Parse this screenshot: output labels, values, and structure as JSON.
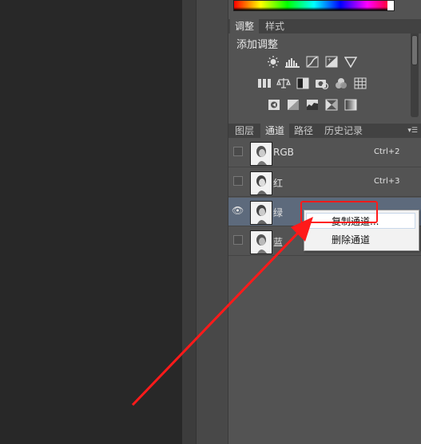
{
  "adjustments_panel": {
    "tabs": [
      {
        "label": "调整",
        "active": true
      },
      {
        "label": "样式",
        "active": false
      }
    ],
    "add_adjustment_label": "添加调整",
    "icons_row1": [
      "brightness-contrast-icon",
      "levels-icon",
      "curves-icon",
      "exposure-icon",
      "vibrance-icon"
    ],
    "icons_row2": [
      "hue-saturation-icon",
      "color-balance-icon",
      "black-white-icon",
      "photo-filter-icon",
      "channel-mixer-icon",
      "color-lookup-icon"
    ],
    "icons_row3": [
      "invert-icon",
      "posterize-icon",
      "threshold-icon",
      "selective-color-icon",
      "gradient-map-icon"
    ]
  },
  "layers_panel": {
    "tabs": [
      {
        "label": "图层",
        "active": false
      },
      {
        "label": "通道",
        "active": true
      },
      {
        "label": "路径",
        "active": false
      },
      {
        "label": "历史记录",
        "active": false
      }
    ],
    "channels": [
      {
        "name": "RGB",
        "shortcut": "Ctrl+2",
        "visible": false,
        "selected": false
      },
      {
        "name": "红",
        "shortcut": "Ctrl+3",
        "visible": false,
        "selected": false
      },
      {
        "name": "绿",
        "shortcut": "",
        "visible": true,
        "selected": true
      },
      {
        "name": "蓝",
        "shortcut": "",
        "visible": false,
        "selected": false
      }
    ]
  },
  "context_menu": {
    "items": [
      {
        "label": "复制通道..."
      },
      {
        "label": "删除通道"
      }
    ]
  },
  "colors": {
    "annotation_red": "#ff1a1a",
    "selected_row": "#5d6a7c",
    "panel_bg": "#535353"
  }
}
